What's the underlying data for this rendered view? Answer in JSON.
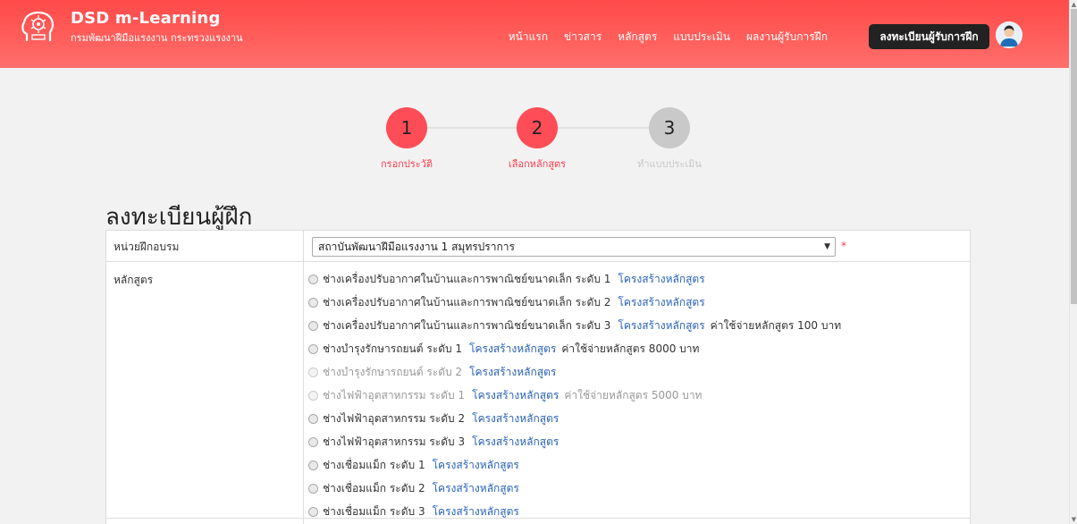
{
  "brand": {
    "title": "DSD m-Learning",
    "subtitle": "กรมพัฒนาฝีมือแรงงาน กระทรวงแรงงาน",
    "logo_icon": "brain-head-icon"
  },
  "nav": {
    "items": [
      "หน้าแรก",
      "ข่าวสาร",
      "หลักสูตร",
      "แบบประเมิน",
      "ผลงานผู้รับการฝึก"
    ],
    "register_label": "ลงทะเบียนผู้รับการฝึก",
    "avatar_icon": "user-avatar-icon"
  },
  "steps": [
    {
      "number": "1",
      "label": "กรอกประวัติ",
      "state": "active"
    },
    {
      "number": "2",
      "label": "เลือกหลักสูตร",
      "state": "active"
    },
    {
      "number": "3",
      "label": "ทำแบบประเมิน",
      "state": "inactive"
    }
  ],
  "page_title": "ลงทะเบียนผู้ฝึก",
  "form": {
    "unit_label": "หน่วยฝึกอบรม",
    "unit_value": "สถาบันพัฒนาฝีมือแรงงาน 1 สมุทรปราการ",
    "required_mark": "*",
    "course_label": "หลักสูตร",
    "courses": [
      {
        "name": "ช่างเครื่องปรับอากาศในบ้านและการพาณิชย์ขนาดเล็ก ระดับ 1",
        "link": "โครงสร้างหลักสูตร",
        "fee": "",
        "disabled": false
      },
      {
        "name": "ช่างเครื่องปรับอากาศในบ้านและการพาณิชย์ขนาดเล็ก ระดับ 2",
        "link": "โครงสร้างหลักสูตร",
        "fee": "",
        "disabled": false
      },
      {
        "name": "ช่างเครื่องปรับอากาศในบ้านและการพาณิชย์ขนาดเล็ก ระดับ 3",
        "link": "โครงสร้างหลักสูตร",
        "fee": "ค่าใช้จ่ายหลักสูตร 100 บาท",
        "disabled": false
      },
      {
        "name": "ช่างบำรุงรักษารถยนต์ ระดับ 1",
        "link": "โครงสร้างหลักสูตร",
        "fee": "ค่าใช้จ่ายหลักสูตร 8000 บาท",
        "disabled": false
      },
      {
        "name": "ช่างบำรุงรักษารถยนต์ ระดับ 2",
        "link": "โครงสร้างหลักสูตร",
        "fee": "",
        "disabled": true
      },
      {
        "name": "ช่างไฟฟ้าอุตสาหกรรม ระดับ 1",
        "link": "โครงสร้างหลักสูตร",
        "fee": "ค่าใช้จ่ายหลักสูตร 5000 บาท",
        "disabled": true
      },
      {
        "name": "ช่างไฟฟ้าอุตสาหกรรม ระดับ 2",
        "link": "โครงสร้างหลักสูตร",
        "fee": "",
        "disabled": false
      },
      {
        "name": "ช่างไฟฟ้าอุตสาหกรรม ระดับ 3",
        "link": "โครงสร้างหลักสูตร",
        "fee": "",
        "disabled": false
      },
      {
        "name": "ช่างเชื่อมแม็ก ระดับ 1",
        "link": "โครงสร้างหลักสูตร",
        "fee": "",
        "disabled": false
      },
      {
        "name": "ช่างเชื่อมแม็ก ระดับ 2",
        "link": "โครงสร้างหลักสูตร",
        "fee": "",
        "disabled": false
      },
      {
        "name": "ช่างเชื่อมแม็ก ระดับ 3",
        "link": "โครงสร้างหลักสูตร",
        "fee": "",
        "disabled": false
      }
    ]
  },
  "colors": {
    "header_red": "#ff4a4a",
    "step_active": "#ff4d57",
    "step_inactive": "#c9c9c9",
    "link_blue": "#2a62b8"
  }
}
